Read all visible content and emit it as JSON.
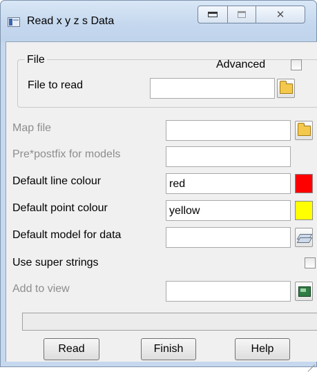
{
  "window": {
    "title": "Read x y z s Data",
    "controls": {
      "minimize": "minimize-icon",
      "maximize": "maximize-icon",
      "close": "close-icon"
    }
  },
  "file_group": {
    "label": "File",
    "advanced_label": "Advanced",
    "advanced_checked": false,
    "file_to_read_label": "File to read",
    "file_to_read_value": ""
  },
  "form": {
    "map_file": {
      "label": "Map file",
      "value": "",
      "enabled": false
    },
    "prefix": {
      "label": "Pre*postfix for models",
      "value": "",
      "enabled": false
    },
    "line_colour": {
      "label": "Default line colour",
      "value": "red",
      "swatch": "#ff0000"
    },
    "point_colour": {
      "label": "Default point colour",
      "value": "yellow",
      "swatch": "#ffff00"
    },
    "model": {
      "label": "Default model for data",
      "value": ""
    },
    "super_strings": {
      "label": "Use super strings",
      "checked": false
    },
    "add_to_view": {
      "label": "Add to view",
      "value": "",
      "enabled": false
    }
  },
  "status": {
    "text": ""
  },
  "buttons": {
    "read": "Read",
    "finish": "Finish",
    "help": "Help"
  }
}
